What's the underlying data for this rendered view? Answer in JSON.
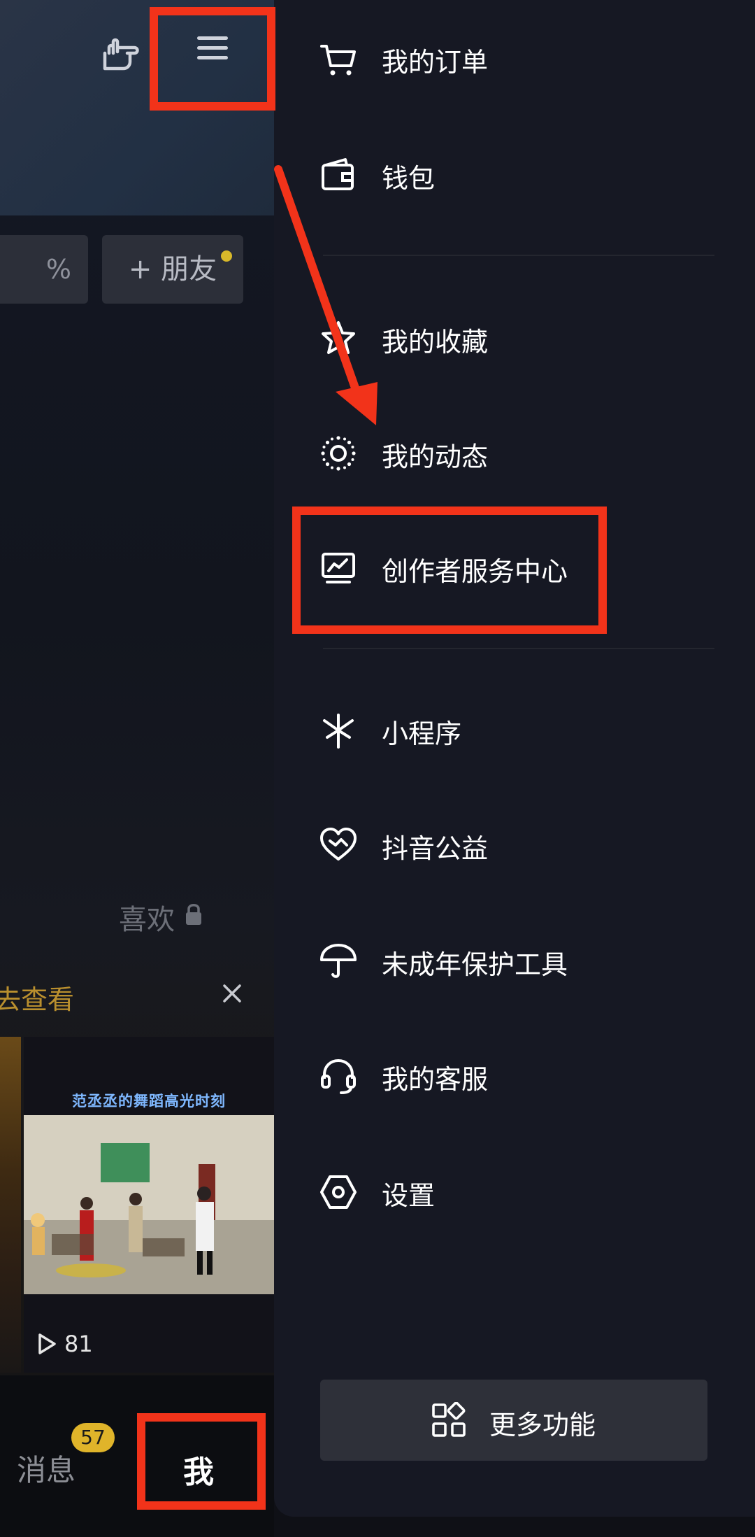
{
  "profile": {
    "chip_pct": "%",
    "friend_button": "+ 朋友",
    "likes_tab": "喜欢",
    "notice": "去查看",
    "video": {
      "caption": "范丞丞的舞蹈高光时刻",
      "play_count": "81"
    }
  },
  "bottom_nav": {
    "messages": "消息",
    "messages_badge": "57",
    "me": "我"
  },
  "drawer": {
    "items": [
      {
        "label": "我的订单",
        "icon": "cart-icon"
      },
      {
        "label": "钱包",
        "icon": "wallet-icon"
      },
      {
        "label": "我的收藏",
        "icon": "star-icon"
      },
      {
        "label": "我的动态",
        "icon": "sun-icon"
      },
      {
        "label": "创作者服务中心",
        "icon": "creator-monitor-icon"
      },
      {
        "label": "小程序",
        "icon": "mini-program-icon"
      },
      {
        "label": "抖音公益",
        "icon": "charity-heart-icon"
      },
      {
        "label": "未成年保护工具",
        "icon": "umbrella-icon"
      },
      {
        "label": "我的客服",
        "icon": "headset-icon"
      },
      {
        "label": "设置",
        "icon": "settings-hex-icon"
      }
    ],
    "more_button": "更多功能"
  },
  "colors": {
    "annotation_red": "#f2331a",
    "drawer_bg": "#161823",
    "badge_yellow": "#e0b42a",
    "notice_gold": "#b98f2e"
  }
}
